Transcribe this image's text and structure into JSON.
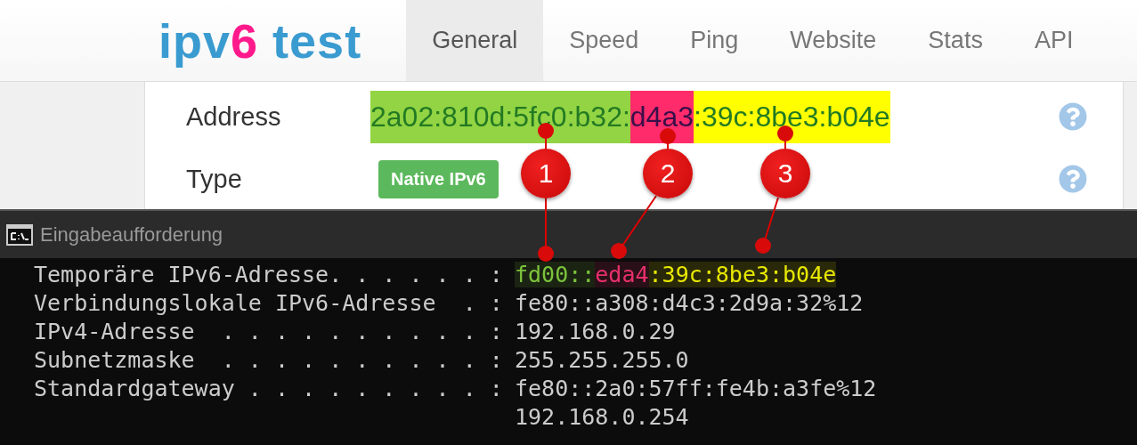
{
  "logo": {
    "before": "ipv",
    "accent": "6",
    "after": " test"
  },
  "nav": [
    {
      "label": "General",
      "selected": true
    },
    {
      "label": "Speed",
      "selected": false
    },
    {
      "label": "Ping",
      "selected": false
    },
    {
      "label": "Website",
      "selected": false
    },
    {
      "label": "Stats",
      "selected": false
    },
    {
      "label": "API",
      "selected": false
    }
  ],
  "info_rows": [
    {
      "kind": "address",
      "label": "Address",
      "segments": [
        {
          "text": "2a02:810d:5fc0:b32:",
          "color": "#92d443"
        },
        {
          "text": "d4a3",
          "color": "#ff2b6a"
        },
        {
          "text": ":39c:8be3:b04e",
          "color": "#ffff00"
        }
      ]
    },
    {
      "kind": "badge",
      "label": "Type",
      "badge": "Native IPv6"
    }
  ],
  "console": {
    "title": "Eingabeaufforderung",
    "lines": [
      {
        "label": "Temporäre IPv6-Adresse. . . . . . :",
        "segments": [
          {
            "text": "fd00::",
            "color": "#7cc43c"
          },
          {
            "text": "eda4",
            "color": "#e8306a"
          },
          {
            "text": ":39c:8be3:b04e",
            "color": "#e8e800"
          }
        ]
      },
      {
        "label": "Verbindungslokale IPv6-Adresse  . :",
        "value": "fe80::a308:d4c3:2d9a:32%12"
      },
      {
        "label": "IPv4-Adresse  . . . . . . . . . . :",
        "value": "192.168.0.29"
      },
      {
        "label": "Subnetzmaske  . . . . . . . . . . :",
        "value": "255.255.255.0"
      },
      {
        "label": "Standardgateway . . . . . . . . . :",
        "value": "fe80::2a0:57ff:fe4b:a3fe%12"
      },
      {
        "value": "192.168.0.254"
      }
    ]
  },
  "callouts": [
    {
      "number": "1"
    },
    {
      "number": "2"
    },
    {
      "number": "3"
    }
  ]
}
